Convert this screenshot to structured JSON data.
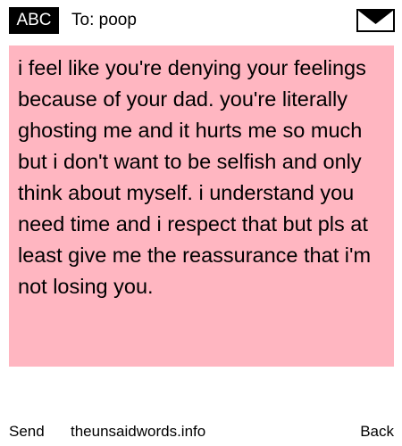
{
  "header": {
    "badge": "ABC",
    "to_text": "To: poop",
    "mail_icon": "envelope-icon"
  },
  "message": {
    "body": "i feel like you're denying your feelings because of your dad. you're literally ghosting me and it hurts me so much but i don't want to be selfish and only think about myself. i understand you need time and i respect that but pls at least give me the reassurance that i'm not losing you."
  },
  "footer": {
    "send_label": "Send",
    "site_label": "theunsaidwords.info",
    "back_label": "Back"
  },
  "colors": {
    "message_background": "#ffb6c1",
    "badge_background": "#000000",
    "page_background": "#ffffff"
  }
}
